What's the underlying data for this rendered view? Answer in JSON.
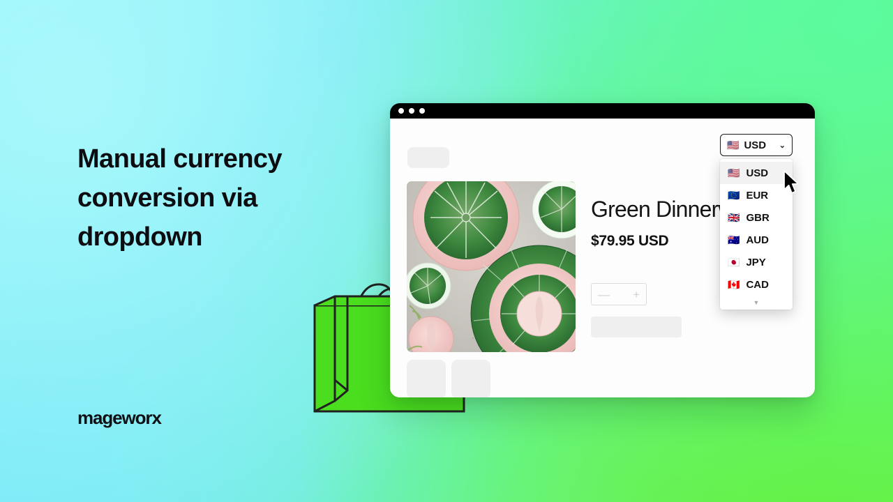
{
  "headline": "Manual currency conversion via dropdown",
  "brand_logo": "mageworx",
  "browser": {
    "dots": [
      "dot-1",
      "dot-2",
      "dot-3"
    ],
    "nav_placeholder_label": ""
  },
  "product": {
    "title": "Green Dinnerware",
    "price": "$79.95 USD",
    "quantity_minus": "—",
    "quantity_plus": "+",
    "add_to_cart_placeholder": "",
    "image_alt": "green cabbage leaf dinnerware plates and bowls",
    "thumbnails": [
      "thumb-1",
      "thumb-2"
    ]
  },
  "currency_selector": {
    "selected_flag": "🇺🇸",
    "selected_code": "USD",
    "chevron": "⌄",
    "more_arrow": "▼",
    "options": [
      {
        "flag": "🇺🇸",
        "code": "USD",
        "selected": true
      },
      {
        "flag": "🇪🇺",
        "code": "EUR",
        "selected": false
      },
      {
        "flag": "🇬🇧",
        "code": "GBR",
        "selected": false
      },
      {
        "flag": "🇦🇺",
        "code": "AUD",
        "selected": false
      },
      {
        "flag": "🇯🇵",
        "code": "JPY",
        "selected": false
      },
      {
        "flag": "🇨🇦",
        "code": "CAD",
        "selected": false
      }
    ]
  },
  "colors": {
    "bg_cyan": "#a8f8fb",
    "bg_mint": "#5cfb9d",
    "bg_green": "#64f243",
    "bag_green": "#4ade1f",
    "text_dark": "#0d0d11",
    "titlebar": "#000000",
    "skeleton": "#efefef"
  }
}
